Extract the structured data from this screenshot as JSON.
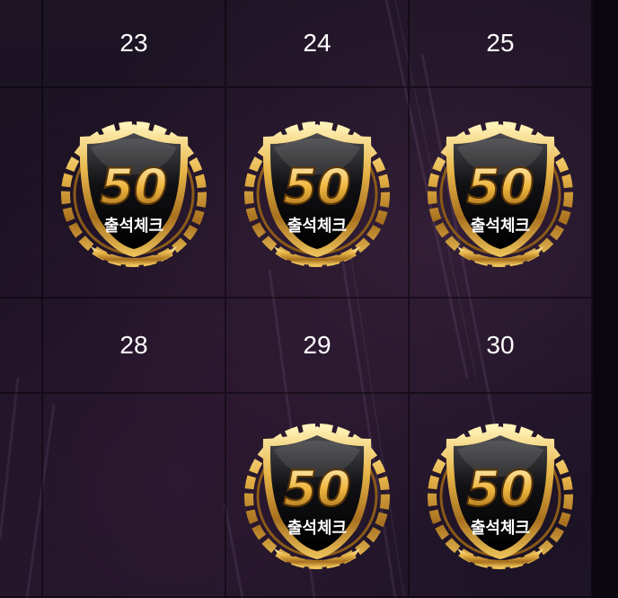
{
  "calendar": {
    "week1": {
      "days": [
        "23",
        "24",
        "25"
      ],
      "stamps": [
        true,
        true,
        true
      ]
    },
    "week2": {
      "days": [
        "28",
        "29",
        "30"
      ],
      "stamps": [
        false,
        true,
        true
      ]
    }
  },
  "badge": {
    "number": "50",
    "label": "출석체크"
  },
  "colors": {
    "background": "#1a1122",
    "gold": "#d9a53a",
    "text": "#ffffff"
  }
}
